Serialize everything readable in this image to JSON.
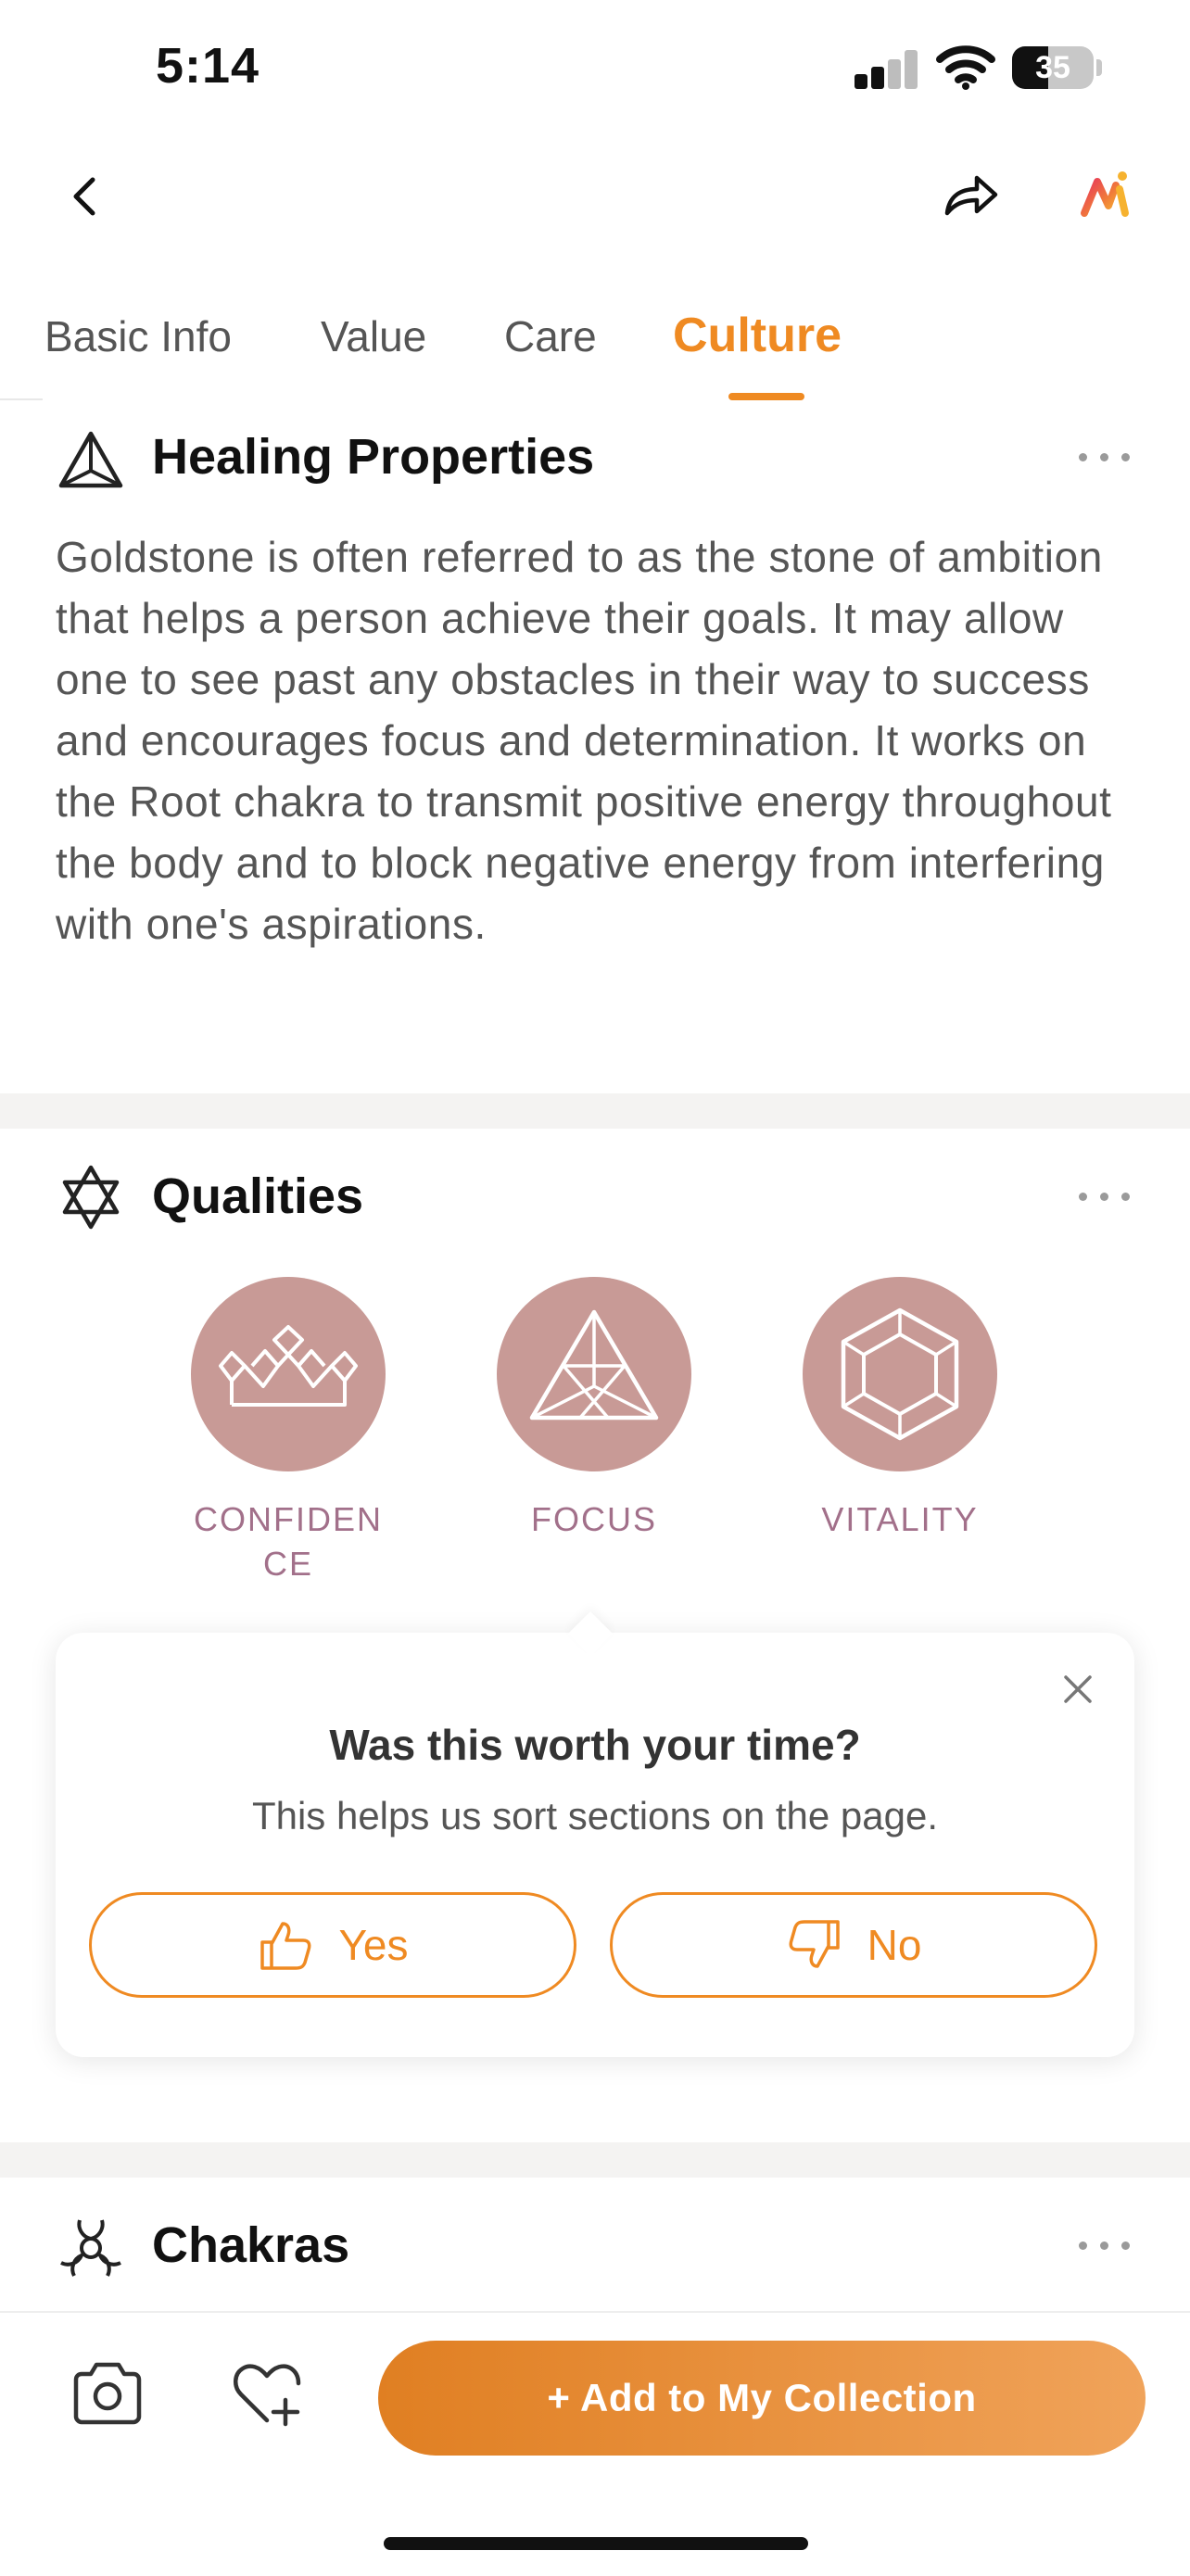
{
  "status_bar": {
    "time": "5:14",
    "battery": "35"
  },
  "tabs": [
    {
      "label": "Basic Info"
    },
    {
      "label": "Value"
    },
    {
      "label": "Care"
    },
    {
      "label": "Culture"
    }
  ],
  "active_tab": "Culture",
  "healing": {
    "title": "Healing Properties",
    "icon": "triangle-icon",
    "text": "Goldstone is often referred to as the stone of ambition that helps a person achieve their goals. It may allow one to see past any obstacles in their way to success and encourages focus and determination. It works on the Root chakra to transmit positive energy throughout the body and to block negative energy from interfering with one's aspirations."
  },
  "qualities": {
    "title": "Qualities",
    "icon": "star-of-david-icon",
    "items": [
      {
        "label": "CONFIDEN CE",
        "icon": "crown-icon"
      },
      {
        "label": "FOCUS",
        "icon": "pyramid-icon"
      },
      {
        "label": "VITALITY",
        "icon": "hexagon-gem-icon"
      }
    ]
  },
  "feedback": {
    "title": "Was this worth your time?",
    "subtitle": "This helps us sort sections on the page.",
    "yes": "Yes",
    "no": "No"
  },
  "chakras": {
    "title": "Chakras",
    "icon": "chakra-symbol-icon"
  },
  "bottom": {
    "add_label": "+ Add to My Collection"
  },
  "colors": {
    "accent": "#ef8a22",
    "quality_circle": "#c89a96",
    "quality_label": "#a2708a"
  }
}
